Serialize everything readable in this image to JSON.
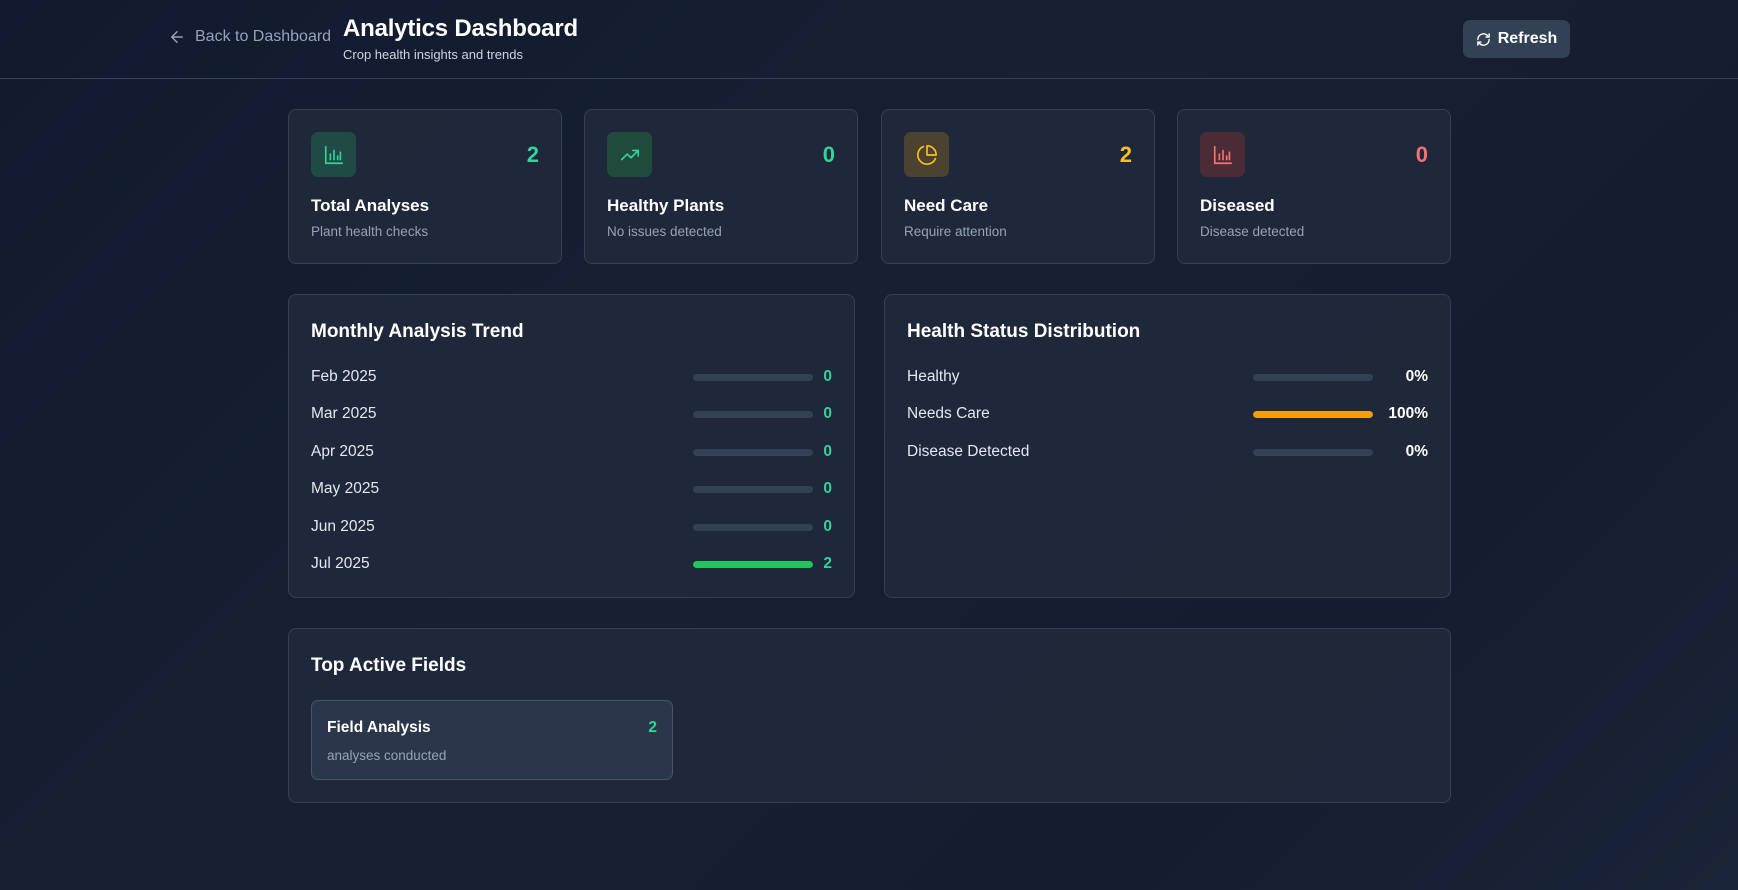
{
  "header": {
    "back_label": "Back to Dashboard",
    "title": "Analytics Dashboard",
    "subtitle": "Crop health insights and trends",
    "refresh_label": "Refresh"
  },
  "stats": [
    {
      "icon": "bar-chart-icon",
      "value": "2",
      "label": "Total Analyses",
      "desc": "Plant health checks",
      "color": "#34d399",
      "icon_bg": "#1f4a45"
    },
    {
      "icon": "trending-up-icon",
      "value": "0",
      "label": "Healthy Plants",
      "desc": "No issues detected",
      "color": "#34d399",
      "icon_bg": "#1f4a3c"
    },
    {
      "icon": "pie-chart-icon",
      "value": "2",
      "label": "Need Care",
      "desc": "Require attention",
      "color": "#fbbf24",
      "icon_bg": "#4b4230"
    },
    {
      "icon": "bar-chart-icon",
      "value": "0",
      "label": "Diseased",
      "desc": "Disease detected",
      "color": "#f87171",
      "icon_bg": "#4a2b36"
    }
  ],
  "monthly": {
    "title": "Monthly Analysis Trend",
    "bar_color": "#22c55e",
    "value_color": "#34d399",
    "rows": [
      {
        "label": "Feb 2025",
        "value": "0",
        "fraction": 0
      },
      {
        "label": "Mar 2025",
        "value": "0",
        "fraction": 0
      },
      {
        "label": "Apr 2025",
        "value": "0",
        "fraction": 0
      },
      {
        "label": "May 2025",
        "value": "0",
        "fraction": 0
      },
      {
        "label": "Jun 2025",
        "value": "0",
        "fraction": 0
      },
      {
        "label": "Jul 2025",
        "value": "2",
        "fraction": 1
      }
    ]
  },
  "distribution": {
    "title": "Health Status Distribution",
    "rows": [
      {
        "label": "Healthy",
        "value": "0%",
        "fraction": 0,
        "color": "#22c55e"
      },
      {
        "label": "Needs Care",
        "value": "100%",
        "fraction": 1,
        "color": "#f59e0b"
      },
      {
        "label": "Disease Detected",
        "value": "0%",
        "fraction": 0,
        "color": "#ef4444"
      }
    ]
  },
  "fields": {
    "title": "Top Active Fields",
    "items": [
      {
        "name": "Field Analysis",
        "count": "2",
        "desc": "analyses conducted"
      }
    ]
  }
}
